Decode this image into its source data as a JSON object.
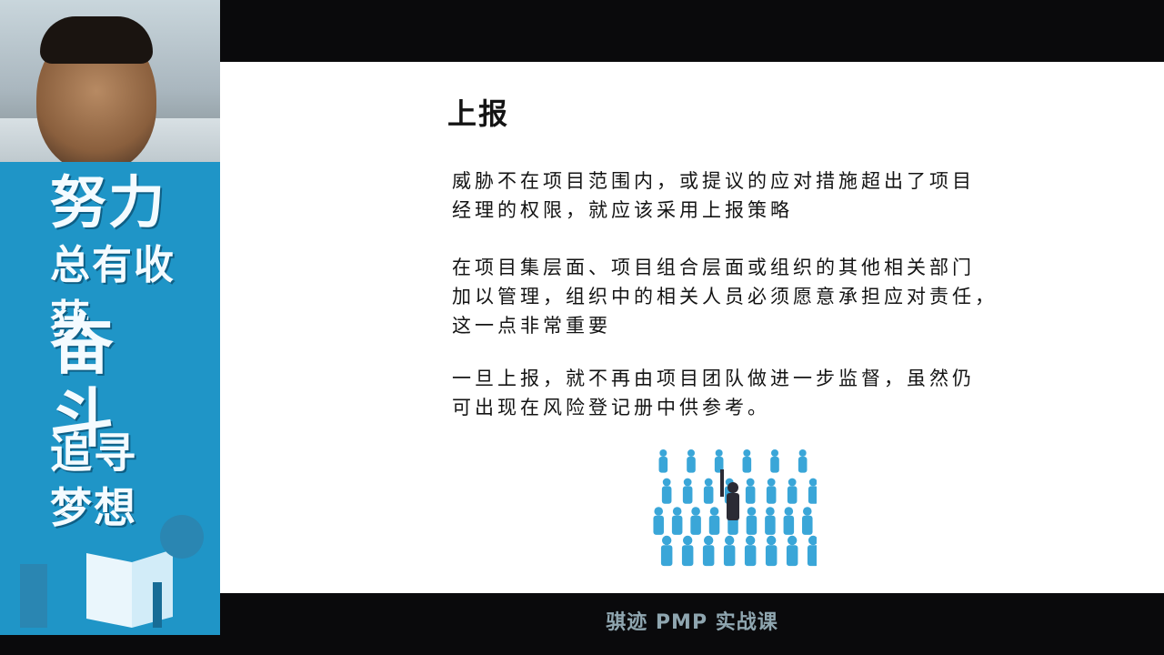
{
  "sidebar": {
    "slogan_line1": "努力",
    "slogan_line2": "总有收获",
    "slogan_line3": "奋斗",
    "slogan_line4": "追寻梦想"
  },
  "slide": {
    "title": "上报",
    "paragraphs": [
      "威胁不在项目范围内，或提议的应对措施超出了项目\n经理的权限，就应该采用上报策略",
      "在项目集层面、项目组合层面或组织的其他相关部门\n加以管理，组织中的相关人员必须愿意承担应对责任，\n这一点非常重要",
      "一旦上报，就不再由项目团队做进一步监督，虽然仍\n可出现在风险登记册中供参考。"
    ],
    "image_icon": "crowd-raised-hand-icon"
  },
  "watermark": "骐迹 PMP 实战课",
  "colors": {
    "sidebar_bg": "#1f95c7",
    "slide_bg": "#ffffff",
    "frame_bg": "#0a0a0c",
    "crowd_blue": "#3aa6d8",
    "crowd_highlight": "#2b2b35"
  }
}
